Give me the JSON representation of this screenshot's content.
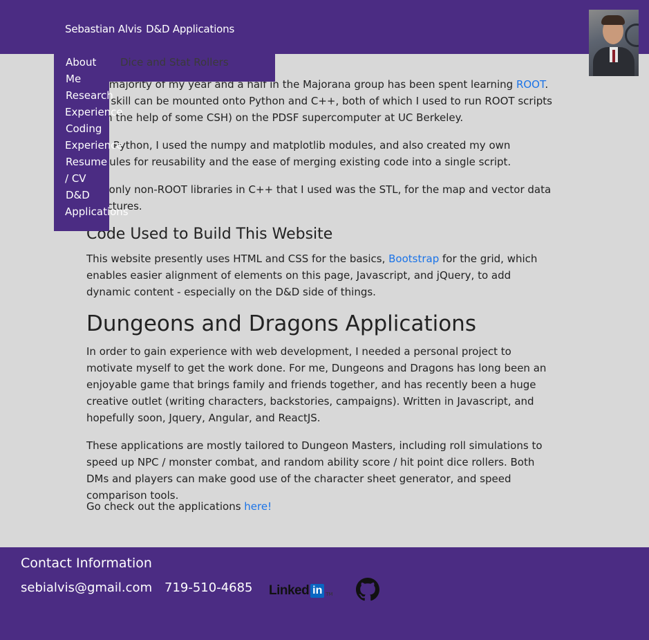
{
  "navbar": {
    "brand_name": "Sebastian Alvis",
    "brand_apps": "D&D Applications",
    "dropdown_sub": "Dice and Stat Rollers",
    "side_items": [
      {
        "label": "About"
      },
      {
        "label": "Me"
      },
      {
        "label": "Research"
      },
      {
        "label": "Experience"
      },
      {
        "label": "Coding"
      },
      {
        "label": "Experience"
      },
      {
        "label": "Resume"
      },
      {
        "label": "/ CV"
      },
      {
        "label": "D&D"
      },
      {
        "label": "Applications"
      }
    ]
  },
  "content": {
    "p1_start": "The majority of my year and a half in the Majorana group has been spent learning ",
    "p1_link": "ROOT",
    "p1_end": ". This skill can be mounted onto Python and C++, both of which I used to run ROOT scripts (with the help of some CSH) on the PDSF supercomputer at UC Berkeley.",
    "p2": "With Python, I used the numpy and matplotlib modules, and also created my own modules for reusability and the ease of merging existing code into a single script.",
    "p3": "The only non-ROOT libraries in C++ that I used was the STL, for the map and vector data structures.",
    "code_heading": "Code Used to Build This Website",
    "p4_start": "This website presently uses HTML and CSS for the basics, ",
    "p4_link": "Bootstrap",
    "p4_end": " for the grid, which enables easier alignment of elements on this page, Javascript, and jQuery, to add dynamic content - especially on the D&D side of things.",
    "dnd_heading": "Dungeons and Dragons Applications",
    "p5": "In order to gain experience with web development, I needed a personal project to motivate myself to get the work done. For me, Dungeons and Dragons has long been an enjoyable game that brings family and friends together, and has recently been a huge creative outlet (writing characters, backstories, campaigns). Written in Javascript, and hopefully soon, Jquery, Angular, and ReactJS.",
    "p6": "These applications are mostly tailored to Dungeon Masters, including roll simulations to speed up NPC / monster combat, and random ability score / hit point dice rollers. Both DMs and players can make good use of the character sheet generator, and speed comparison tools.",
    "p7_start": "Go check out the applications ",
    "p7_link": "here!"
  },
  "footer": {
    "title": "Contact Information",
    "email": "sebialvis@gmail.com",
    "phone": "719-510-4685",
    "linkedin_word": "Linked",
    "linkedin_in": "in",
    "linkedin_tm": "TM",
    "linkedin_icon": "linkedin-logo",
    "github_icon": "github-icon"
  },
  "colors": {
    "brand_purple": "#4b2c83",
    "background": "#d8d8d8",
    "link_blue": "#1a73e8"
  }
}
